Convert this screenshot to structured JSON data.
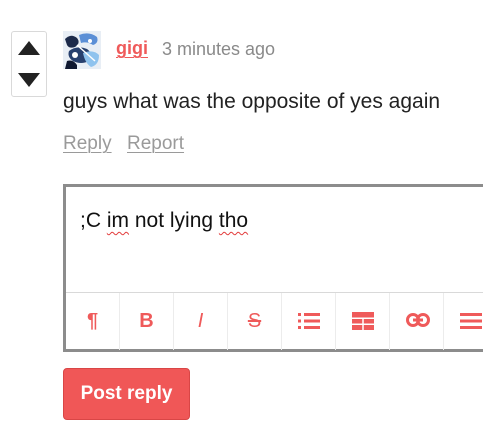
{
  "comment": {
    "username": "gigi",
    "timestamp": "3 minutes ago",
    "text": "guys what was the opposite of yes again",
    "actions": {
      "reply": "Reply",
      "report": "Report"
    }
  },
  "vote": {
    "up_icon": "triangle-up-icon",
    "down_icon": "triangle-down-icon"
  },
  "editor": {
    "segments": [
      ";C ",
      "im",
      " not lying ",
      "tho"
    ],
    "misspelled": [
      "im",
      "tho"
    ],
    "toolbar": [
      {
        "name": "paragraph-icon",
        "glyph": "¶"
      },
      {
        "name": "bold-icon",
        "glyph": "B"
      },
      {
        "name": "italic-icon",
        "glyph": "I"
      },
      {
        "name": "strikethrough-icon",
        "glyph": "S"
      },
      {
        "name": "bulleted-list-icon",
        "glyph": ""
      },
      {
        "name": "table-icon",
        "glyph": ""
      },
      {
        "name": "link-icon",
        "glyph": ""
      },
      {
        "name": "align-icon",
        "glyph": ""
      }
    ]
  },
  "post_button": {
    "label": "Post reply"
  },
  "colors": {
    "accent": "#ef5a5a",
    "muted": "#9a9a9a",
    "text": "#222222",
    "border": "#8c8c8c"
  }
}
